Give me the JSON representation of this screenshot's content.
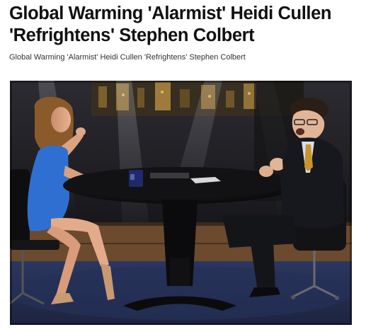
{
  "article": {
    "headline": "Global Warming 'Alarmist' Heidi Cullen 'Refrightens' Stephen Colbert",
    "caption": "Global Warming 'Alarmist' Heidi Cullen 'Refrightens' Stephen Colbert"
  },
  "media": {
    "kind": "video-still",
    "palette": {
      "backdrop": "#1c1c22",
      "floor": "#2a3452",
      "wall_panel": "#6b4a2e",
      "table": "#0d0d0f",
      "dress": "#2f6fd1",
      "skin": "#d9a07e",
      "suit": "#17181d",
      "tie": "#c8952c"
    }
  }
}
